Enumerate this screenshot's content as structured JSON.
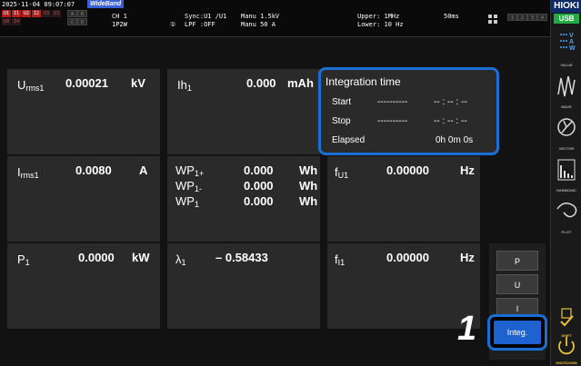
{
  "status_bar": {
    "datetime": "2025-11-04 09:07:07",
    "wideband": "WideBand",
    "ch_label": "CH 1",
    "wiring": "1P2W",
    "circle_num": "①",
    "sync": "Sync:U1  /U1",
    "lpf": "LPF :OFF",
    "manu_v": "Manu 1.5kV",
    "manu_a": "Manu  50 A",
    "upper": "Upper: 1MHz",
    "lower": "Lower: 10 Hz",
    "interval": "50ms",
    "ind_row1": [
      "A",
      "B"
    ],
    "ind_row2": [
      "C",
      "D"
    ],
    "red_labels": [
      "U1",
      "I1",
      "U2",
      "I2"
    ],
    "red_labels2": [
      "U3",
      "I3",
      "U4",
      "I4"
    ],
    "gray_labels": [
      "1",
      "2",
      "3",
      "4"
    ]
  },
  "panels": {
    "urms": {
      "label_main": "U",
      "label_sub": "rms1",
      "value": "0.00021",
      "unit": "kV"
    },
    "ih": {
      "label_main": "Ih",
      "label_sub": "1",
      "value": "0.000",
      "unit": "mAh"
    },
    "irms": {
      "label_main": "I",
      "label_sub": "rms1",
      "value": "0.0080",
      "unit": "A"
    },
    "wp_plus": {
      "label_main": "WP",
      "label_sub": "1+",
      "value": "0.000",
      "unit": "Wh"
    },
    "wp_minus": {
      "label_main": "WP",
      "label_sub": "1-",
      "value": "0.000",
      "unit": "Wh"
    },
    "wp": {
      "label_main": "WP",
      "label_sub": "1",
      "value": "0.000",
      "unit": "Wh"
    },
    "fu": {
      "label_main": "f",
      "label_sub": "U1",
      "value": "0.00000",
      "unit": "Hz"
    },
    "p": {
      "label_main": "P",
      "label_sub": "1",
      "value": "0.0000",
      "unit": "kW"
    },
    "lambda": {
      "label_main": "λ",
      "label_sub": "1",
      "value": "– 0.58433",
      "unit": ""
    },
    "fi": {
      "label_main": "f",
      "label_sub": "I1",
      "value": "0.00000",
      "unit": "Hz"
    }
  },
  "integration": {
    "title": "Integration time",
    "start_label": "Start",
    "start_dash": "----------",
    "start_value": "-- : -- : --",
    "stop_label": "Stop",
    "stop_dash": "----------",
    "stop_value": "-- : -- : --",
    "elapsed_label": "Elapsed",
    "elapsed_value": "0h  0m  0s"
  },
  "side_buttons": {
    "p": "P",
    "u": "U",
    "i": "I",
    "integ": "Integ."
  },
  "callout_number": "1",
  "right_sidebar": {
    "brand": "HIOKI",
    "usb": "USB",
    "value": "VALUE",
    "wave": "WAVE",
    "vector": "VECTOR",
    "harmonic": "HARMONIC",
    "plot": "PLOT",
    "shift": "SHIFT",
    "shutdown": "SHUTDOWN"
  }
}
